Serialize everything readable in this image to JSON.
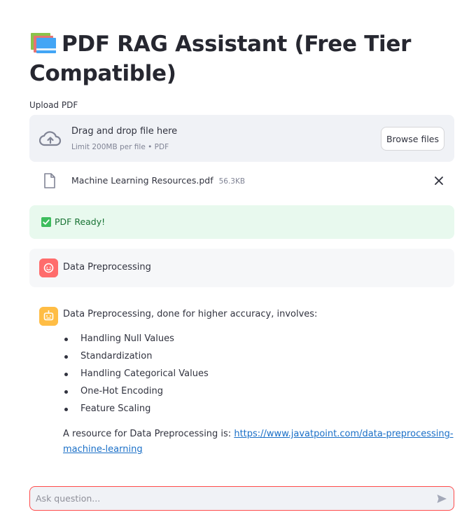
{
  "header": {
    "title": "PDF RAG Assistant (Free Tier Compatible)",
    "icon": "books-icon"
  },
  "uploader": {
    "label": "Upload PDF",
    "drop_text": "Drag and drop file here",
    "limit_text": "Limit 200MB per file • PDF",
    "browse_label": "Browse files",
    "file": {
      "name": "Machine Learning Resources.pdf",
      "size": "56.3KB"
    }
  },
  "status": {
    "text": "PDF Ready!",
    "color": "#177233"
  },
  "chat": {
    "user_message": "Data Preprocessing",
    "assistant": {
      "intro": "Data Preprocessing, done for higher accuracy, involves:",
      "items": [
        "Handling Null Values",
        "Standardization",
        "Handling Categorical Values",
        "One-Hot Encoding",
        "Feature Scaling"
      ],
      "resource_prefix": "A resource for Data Preprocessing is: ",
      "resource_link": "https://www.javatpoint.com/data-preprocessing-machine-learning"
    }
  },
  "input": {
    "placeholder": "Ask question...",
    "value": ""
  },
  "colors": {
    "accent": "#ff4b4b",
    "user_avatar": "#ff6c6c",
    "assistant_avatar": "#ffbd45",
    "success_bg": "#e8f9ee",
    "link": "#1a6fc7"
  }
}
